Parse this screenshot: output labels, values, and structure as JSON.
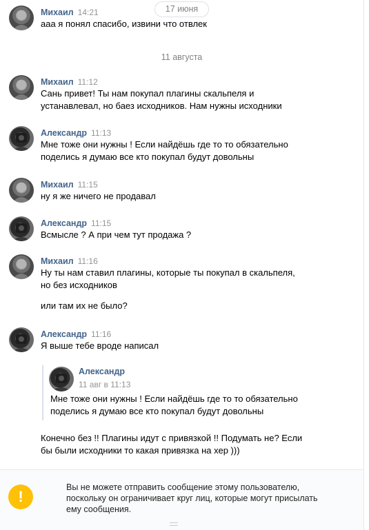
{
  "dates": {
    "first": "17 июня",
    "second": "11 августа"
  },
  "messages": [
    {
      "author": "Михаил",
      "time": "14:21",
      "lines": [
        "ааа я понял спасибо, извини что отвлек"
      ]
    },
    {
      "author": "Михаил",
      "time": "11:12",
      "lines": [
        "Сань привет! Ты нам покупал плагины скальпеля и",
        "устанавлевал, но баез исходников. Нам нужны исходники"
      ]
    },
    {
      "author": "Александр",
      "time": "11:13",
      "lines": [
        "Мне тоже они нужны ! Если найдёшь где то то обязательно",
        "поделись я думаю все кто покупал будут довольны"
      ]
    },
    {
      "author": "Михаил",
      "time": "11:15",
      "lines": [
        "ну я же ничего не продавал"
      ]
    },
    {
      "author": "Александр",
      "time": "11:15",
      "lines": [
        "Всмысле ? А при чем тут продажа ?"
      ]
    },
    {
      "author": "Михаил",
      "time": "11:16",
      "lines": [
        "Ну ты нам ставил плагины, которые ты покупал в скальпеля,",
        "но без исходников"
      ],
      "extra": "или там их не было?"
    },
    {
      "author": "Александр",
      "time": "11:16",
      "lines": [
        "Я выше тебе вроде написал"
      ]
    }
  ],
  "quote": {
    "author": "Александр",
    "date": "11 авг в 11:13",
    "lines": [
      "Мне тоже они нужны ! Если найдёшь где то то обязательно",
      "поделись я думаю все кто покупал будут довольны"
    ]
  },
  "reply": {
    "lines": [
      "Конечно без !! Плагины идут с привязкой !! Подумать не? Если",
      "бы были исходники то какая привязка на хер )))"
    ]
  },
  "notice": {
    "icon": "!",
    "lines": [
      "Вы не можете отправить сообщение этому пользователю,",
      "поскольку он ограничивает круг лиц, которые могут присылать",
      "ему сообщения."
    ]
  }
}
